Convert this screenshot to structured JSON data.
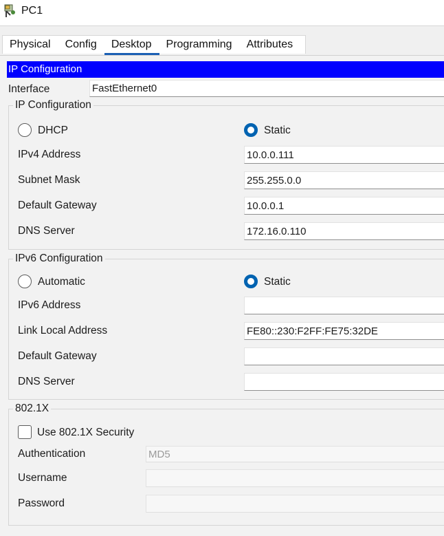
{
  "window": {
    "title": "PC1"
  },
  "tabs": [
    "Physical",
    "Config",
    "Desktop",
    "Programming",
    "Attributes"
  ],
  "active_tab": "Desktop",
  "banner": "IP Configuration",
  "interface": {
    "label": "Interface",
    "value": "FastEthernet0"
  },
  "ipv4": {
    "title": "IP Configuration",
    "dhcp_label": "DHCP",
    "static_label": "Static",
    "mode": "Static",
    "address_label": "IPv4 Address",
    "address": "10.0.0.111",
    "mask_label": "Subnet Mask",
    "mask": "255.255.0.0",
    "gateway_label": "Default Gateway",
    "gateway": "10.0.0.1",
    "dns_label": "DNS Server",
    "dns": "172.16.0.110"
  },
  "ipv6": {
    "title": "IPv6 Configuration",
    "auto_label": "Automatic",
    "static_label": "Static",
    "mode": "Static",
    "address_label": "IPv6 Address",
    "address": "",
    "link_local_label": "Link Local Address",
    "link_local": "FE80::230:F2FF:FE75:32DE",
    "gateway_label": "Default Gateway",
    "gateway": "",
    "dns_label": "DNS Server",
    "dns": ""
  },
  "dot1x": {
    "title": "802.1X",
    "use_label": "Use 802.1X Security",
    "use_checked": false,
    "auth_label": "Authentication",
    "auth_value": "MD5",
    "username_label": "Username",
    "username": "",
    "password_label": "Password",
    "password": ""
  },
  "colors": {
    "banner_bg": "#0000ff",
    "accent": "#0063b1",
    "tab_underline": "#1a5fb4"
  }
}
